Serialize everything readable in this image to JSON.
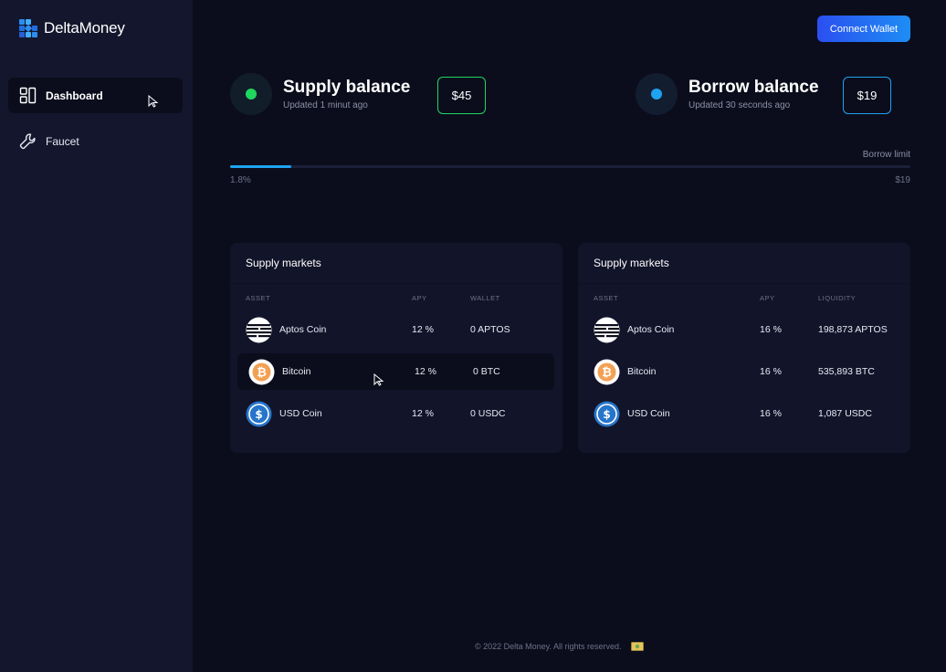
{
  "app": {
    "name": "DeltaMoney"
  },
  "sidebar": {
    "items": [
      {
        "label": "Dashboard",
        "icon": "dashboard-icon",
        "active": true
      },
      {
        "label": "Faucet",
        "icon": "wrench-icon",
        "active": false
      }
    ]
  },
  "header": {
    "connect_label": "Connect Wallet"
  },
  "supply_balance": {
    "title": "Supply balance",
    "updated": "Updated 1 minut ago",
    "amount": "$45",
    "color": "#1fd65f"
  },
  "borrow_balance": {
    "title": "Borrow balance",
    "updated": "Updated 30 seconds ago",
    "amount": "$19",
    "color": "#1fa2f0"
  },
  "borrow_limit": {
    "label": "Borrow limit",
    "percent_label": "1.8%",
    "limit_value": "$19",
    "fill_fraction": 0.09
  },
  "cards": [
    {
      "title": "Supply markets",
      "columns": [
        "ASSET",
        "APY",
        "WALLET"
      ],
      "rows": [
        {
          "asset": "Aptos Coin",
          "icon": "aptos-coin-icon",
          "apy": "12 %",
          "value": "0 APTOS"
        },
        {
          "asset": "Bitcoin",
          "icon": "bitcoin-icon",
          "apy": "12 %",
          "value": "0 BTC"
        },
        {
          "asset": "USD Coin",
          "icon": "usd-coin-icon",
          "apy": "12 %",
          "value": "0 USDC"
        }
      ]
    },
    {
      "title": "Supply markets",
      "columns": [
        "ASSET",
        "APY",
        "LIQUIDITY"
      ],
      "rows": [
        {
          "asset": "Aptos Coin",
          "icon": "aptos-coin-icon",
          "apy": "16 %",
          "value": "198,873 APTOS"
        },
        {
          "asset": "Bitcoin",
          "icon": "bitcoin-icon",
          "apy": "16 %",
          "value": "535,893 BTC"
        },
        {
          "asset": "USD Coin",
          "icon": "usd-coin-icon",
          "apy": "16 %",
          "value": "1,087 USDC"
        }
      ]
    }
  ],
  "footer": {
    "text": "© 2022 Delta Money. All rights reserved."
  }
}
